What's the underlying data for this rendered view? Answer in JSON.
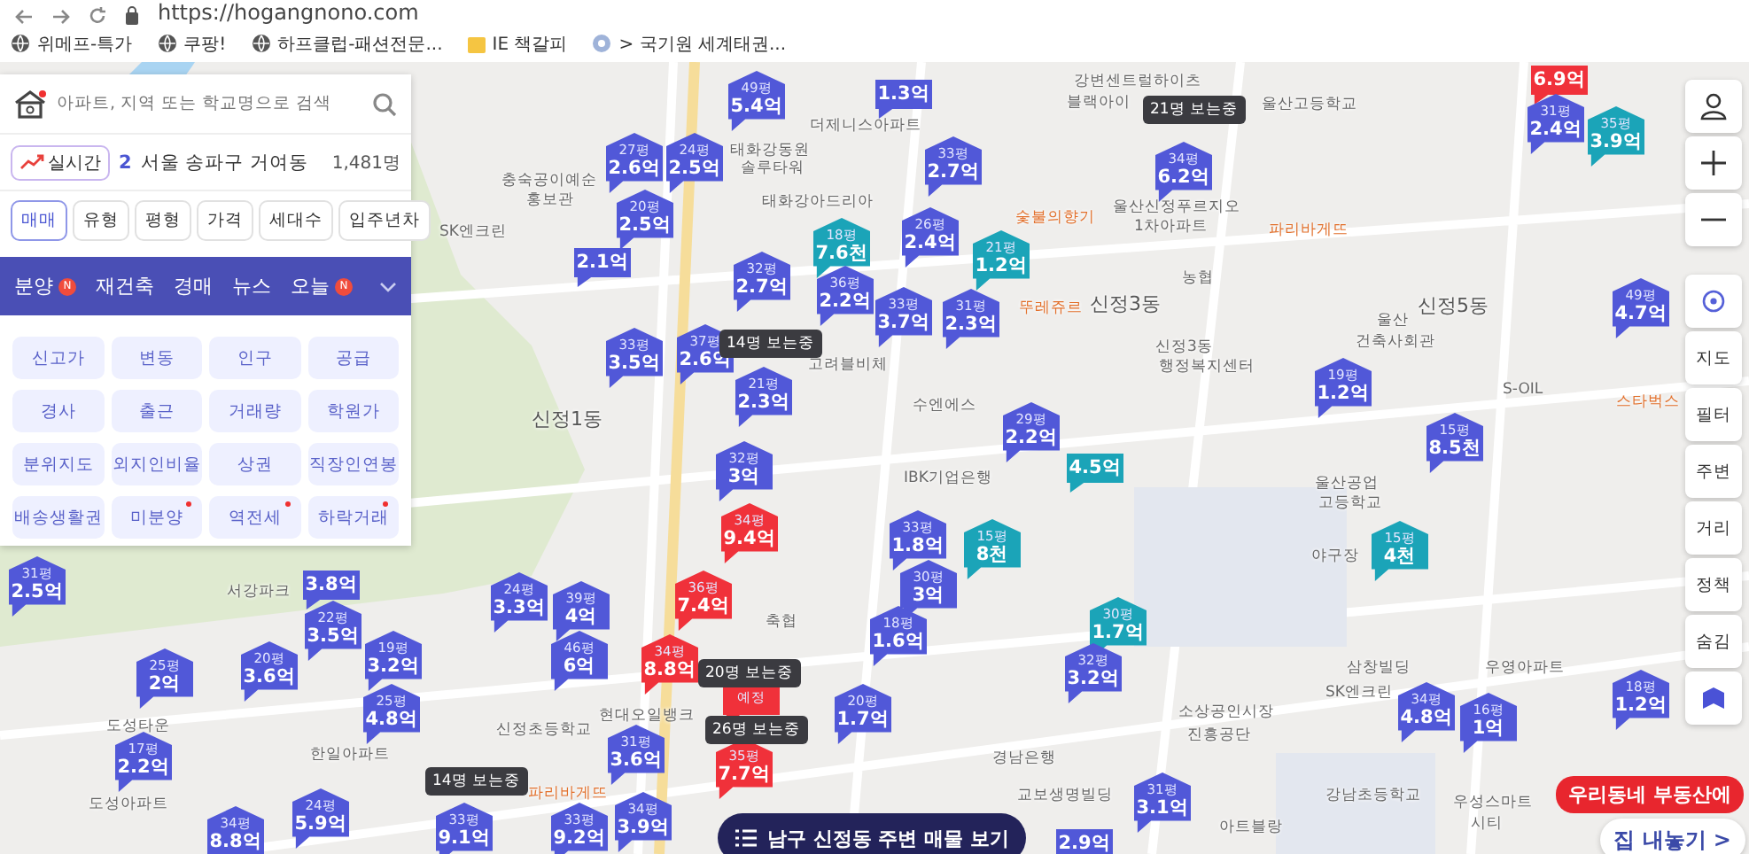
{
  "browser": {
    "url": "https://hogangnono.com",
    "bookmarks": [
      {
        "label": "위메프-특가",
        "kind": "site"
      },
      {
        "label": "쿠팡!",
        "kind": "site"
      },
      {
        "label": "하프클럽-패션전문...",
        "kind": "site"
      },
      {
        "label": "IE 책갈피",
        "kind": "folder"
      },
      {
        "label": "> 국기원 세계태권...",
        "kind": "emblem"
      }
    ]
  },
  "search": {
    "placeholder": "아파트, 지역 또는 학교명으로 검색"
  },
  "trending": {
    "button": "실시간",
    "rank": "2",
    "region": "서울 송파구 거여동",
    "count": "1,481명"
  },
  "filters": [
    {
      "label": "매매",
      "selected": true
    },
    {
      "label": "유형",
      "selected": false
    },
    {
      "label": "평형",
      "selected": false
    },
    {
      "label": "가격",
      "selected": false
    },
    {
      "label": "세대수",
      "selected": false
    },
    {
      "label": "입주년차",
      "selected": false
    }
  ],
  "categories": [
    {
      "label": "분양",
      "new": true,
      "badge": "N"
    },
    {
      "label": "재건축",
      "new": false
    },
    {
      "label": "경매",
      "new": false
    },
    {
      "label": "뉴스",
      "new": false
    },
    {
      "label": "오늘",
      "new": true,
      "badge": "N"
    }
  ],
  "layers": [
    {
      "label": "신고가",
      "dot": false
    },
    {
      "label": "변동",
      "dot": false
    },
    {
      "label": "인구",
      "dot": false
    },
    {
      "label": "공급",
      "dot": false
    },
    {
      "label": "경사",
      "dot": false
    },
    {
      "label": "출근",
      "dot": false
    },
    {
      "label": "거래량",
      "dot": false
    },
    {
      "label": "학원가",
      "dot": false
    },
    {
      "label": "분위지도",
      "dot": false
    },
    {
      "label": "외지인비율",
      "dot": false
    },
    {
      "label": "상권",
      "dot": false
    },
    {
      "label": "직장인연봉",
      "dot": false
    },
    {
      "label": "배송생활권",
      "dot": false
    },
    {
      "label": "미분양",
      "dot": true
    },
    {
      "label": "역전세",
      "dot": true
    },
    {
      "label": "하락거래",
      "dot": true
    }
  ],
  "map": {
    "places": [
      {
        "text": "강변센트럴하이츠",
        "kind": "place"
      },
      {
        "text": "블랙아이",
        "kind": "place"
      },
      {
        "text": "울산고등학교",
        "kind": "place"
      },
      {
        "text": "울산신정푸르지오",
        "kind": "place"
      },
      {
        "text": "1차아파트",
        "kind": "place"
      },
      {
        "text": "더제니스아파트",
        "kind": "place"
      },
      {
        "text": "태화강동원",
        "kind": "place"
      },
      {
        "text": "솔루타워",
        "kind": "place"
      },
      {
        "text": "충숙공이예순",
        "kind": "place"
      },
      {
        "text": "홍보관",
        "kind": "place"
      },
      {
        "text": "태화강아드리아",
        "kind": "place"
      },
      {
        "text": "숯불의향기",
        "kind": "shop"
      },
      {
        "text": "파리바게뜨",
        "kind": "shop"
      },
      {
        "text": "농협",
        "kind": "place"
      },
      {
        "text": "뚜레쥬르",
        "kind": "shop"
      },
      {
        "text": "신정3동",
        "kind": "district"
      },
      {
        "text": "신정5동",
        "kind": "district"
      },
      {
        "text": "SK엔크린",
        "kind": "place"
      },
      {
        "text": "신정1동",
        "kind": "district"
      },
      {
        "text": "고려블비체",
        "kind": "place"
      },
      {
        "text": "수엔에스",
        "kind": "place"
      },
      {
        "text": "신정3동",
        "kind": "place"
      },
      {
        "text": "행정복지센터",
        "kind": "place"
      },
      {
        "text": "울산",
        "kind": "place"
      },
      {
        "text": "건축사회관",
        "kind": "place"
      },
      {
        "text": "S-OIL",
        "kind": "place"
      },
      {
        "text": "스타벅스",
        "kind": "shop"
      },
      {
        "text": "IBK기업은행",
        "kind": "place"
      },
      {
        "text": "울산공업",
        "kind": "place"
      },
      {
        "text": "고등학교",
        "kind": "place"
      },
      {
        "text": "야구장",
        "kind": "place"
      },
      {
        "text": "서강파크",
        "kind": "place"
      },
      {
        "text": "축협",
        "kind": "place"
      },
      {
        "text": "현대오일뱅크",
        "kind": "place"
      },
      {
        "text": "신정초등학교",
        "kind": "place"
      },
      {
        "text": "한일아파트",
        "kind": "place"
      },
      {
        "text": "도성타운",
        "kind": "place"
      },
      {
        "text": "도성아파트",
        "kind": "place"
      },
      {
        "text": "파리바게뜨",
        "kind": "shop"
      },
      {
        "text": "경남은행",
        "kind": "place"
      },
      {
        "text": "교보생명빌딩",
        "kind": "place"
      },
      {
        "text": "아트블랑",
        "kind": "place"
      },
      {
        "text": "강남초등학교",
        "kind": "place"
      },
      {
        "text": "우성스마트",
        "kind": "place"
      },
      {
        "text": "시티",
        "kind": "place"
      },
      {
        "text": "삼창빌딩",
        "kind": "place"
      },
      {
        "text": "우영아파트",
        "kind": "place"
      },
      {
        "text": "SK엔크린",
        "kind": "place"
      },
      {
        "text": "소상공인시장",
        "kind": "place"
      },
      {
        "text": "진흥공단",
        "kind": "place"
      }
    ],
    "markers": [
      {
        "size": "49평",
        "price": "5.4억",
        "color": "#5158d8"
      },
      {
        "price": "1.3억",
        "color": "#5158d8"
      },
      {
        "size": "27평",
        "price": "2.6억",
        "color": "#5158d8"
      },
      {
        "size": "24평",
        "price": "2.5억",
        "color": "#5158d8"
      },
      {
        "size": "20평",
        "price": "2.5억",
        "color": "#5158d8"
      },
      {
        "price": "2.1억",
        "color": "#5158d8"
      },
      {
        "size": "33평",
        "price": "2.7억",
        "color": "#5158d8"
      },
      {
        "size": "34평",
        "price": "6.2억",
        "color": "#5158d8"
      },
      {
        "size": "18평",
        "price": "7.6천",
        "color": "#1ba4b8"
      },
      {
        "size": "26평",
        "price": "2.4억",
        "color": "#5158d8"
      },
      {
        "size": "21평",
        "price": "1.2억",
        "color": "#1ba4b8"
      },
      {
        "size": "32평",
        "price": "2.7억",
        "color": "#5158d8"
      },
      {
        "size": "36평",
        "price": "2.2억",
        "color": "#5158d8"
      },
      {
        "size": "33평",
        "price": "3.7억",
        "color": "#5158d8"
      },
      {
        "size": "31평",
        "price": "2.3억",
        "color": "#5158d8"
      },
      {
        "size": "33평",
        "price": "3.5억",
        "color": "#5158d8"
      },
      {
        "size": "37평",
        "price": "2.6억",
        "color": "#5158d8"
      },
      {
        "size": "21평",
        "price": "2.3억",
        "color": "#5158d8"
      },
      {
        "size": "29평",
        "price": "2.2억",
        "color": "#5158d8"
      },
      {
        "price": "4.5억",
        "color": "#1ba4b8"
      },
      {
        "size": "19평",
        "price": "1.2억",
        "color": "#5158d8"
      },
      {
        "size": "15평",
        "price": "8.5천",
        "color": "#5158d8"
      },
      {
        "size": "32평",
        "price": "3억",
        "color": "#5158d8"
      },
      {
        "size": "34평",
        "price": "9.4억",
        "color": "#f0313a"
      },
      {
        "size": "33평",
        "price": "1.8억",
        "color": "#5158d8"
      },
      {
        "size": "15평",
        "price": "8천",
        "color": "#1ba4b8"
      },
      {
        "size": "30평",
        "price": "3억",
        "color": "#5158d8"
      },
      {
        "size": "15평",
        "price": "4천",
        "color": "#1ba4b8"
      },
      {
        "size": "31평",
        "price": "2.5억",
        "color": "#5158d8"
      },
      {
        "price": "3.8억",
        "color": "#5158d8"
      },
      {
        "size": "24평",
        "price": "3.3억",
        "color": "#5158d8"
      },
      {
        "size": "39평",
        "price": "4억",
        "color": "#5158d8"
      },
      {
        "size": "46평",
        "price": "6억",
        "color": "#5158d8"
      },
      {
        "size": "36평",
        "price": "7.4억",
        "color": "#f0313a"
      },
      {
        "size": "34평",
        "price": "8.8억",
        "color": "#f0313a"
      },
      {
        "size": "22평",
        "price": "3.5억",
        "color": "#5158d8"
      },
      {
        "size": "20평",
        "price": "3.6억",
        "color": "#5158d8"
      },
      {
        "size": "19평",
        "price": "3.2억",
        "color": "#5158d8"
      },
      {
        "size": "25평",
        "price": "2억",
        "color": "#5158d8"
      },
      {
        "size": "25평",
        "price": "4.8억",
        "color": "#5158d8"
      },
      {
        "size": "17평",
        "price": "2.2억",
        "color": "#5158d8"
      },
      {
        "size": "18평",
        "price": "1.6억",
        "color": "#5158d8"
      },
      {
        "size": "30평",
        "price": "1.7억",
        "color": "#1ba4b8"
      },
      {
        "size": "32평",
        "price": "3.2억",
        "color": "#5158d8"
      },
      {
        "size": "예정",
        "color": "#f0313a"
      },
      {
        "size": "20평",
        "price": "1.7억",
        "color": "#5158d8"
      },
      {
        "size": "35평",
        "price": "7.7억",
        "color": "#f0313a"
      },
      {
        "size": "31평",
        "price": "3.6억",
        "color": "#5158d8"
      },
      {
        "size": "34평",
        "price": "8.8억",
        "color": "#5158d8"
      },
      {
        "size": "24평",
        "price": "5.9억",
        "color": "#5158d8"
      },
      {
        "size": "33평",
        "price": "9.1억",
        "color": "#5158d8"
      },
      {
        "size": "33평",
        "price": "9.2억",
        "color": "#5158d8"
      },
      {
        "size": "34평",
        "price": "3.9억",
        "color": "#5158d8"
      },
      {
        "size": "34평",
        "price": "4.8억",
        "color": "#5158d8"
      },
      {
        "size": "16평",
        "price": "1억",
        "color": "#5158d8"
      },
      {
        "size": "49평",
        "price": "4.7억",
        "color": "#5158d8"
      },
      {
        "size": "18평",
        "price": "1.2억",
        "color": "#5158d8"
      },
      {
        "price": "6.9억",
        "color": "#f0313a"
      },
      {
        "size": "31평",
        "price": "2.4억",
        "color": "#5158d8"
      },
      {
        "size": "35평",
        "price": "3.9억",
        "color": "#1ba4b8"
      },
      {
        "size": "31평",
        "price": "3.1억",
        "color": "#5158d8"
      },
      {
        "price": "2.9억",
        "color": "#5158d8"
      }
    ],
    "viewers": [
      "21명 보는중",
      "14명 보는중",
      "20명 보는중",
      "26명 보는중",
      "14명 보는중"
    ]
  },
  "toolbar": [
    "지도",
    "필터",
    "주변",
    "거리",
    "정책",
    "숨김"
  ],
  "nearby_button": "남구 신정동 주변 매물 보기",
  "promo": {
    "bubble": "우리동네 부동산에",
    "button": "집 내놓기 >"
  }
}
